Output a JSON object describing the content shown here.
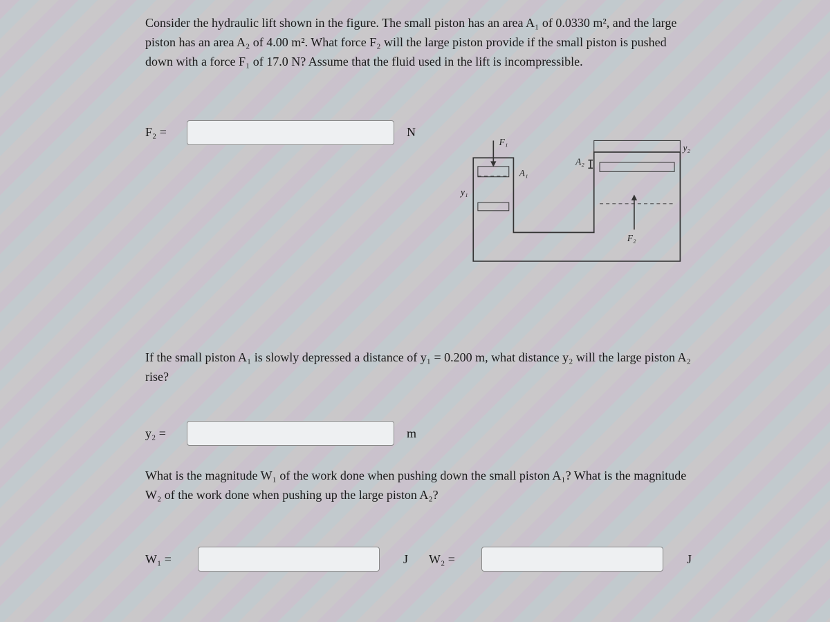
{
  "intro": "Consider the hydraulic lift shown in the figure. The small piston has an area A₁ of 0.0330 m², and the large piston has an area A₂ of 4.00 m². What force F₂ will the large piston provide if the small piston is pushed down with a force F₁ of 17.0 N? Assume that the fluid used in the lift is incompressible.",
  "q1": {
    "label": "F₂ =",
    "unit": "N",
    "value": ""
  },
  "q2_text": "If the small piston A₁ is slowly depressed a distance of y₁ = 0.200 m, what distance y₂ will the large piston A₂ rise?",
  "q2": {
    "label": "y₂ =",
    "unit": "m",
    "value": ""
  },
  "q3_text": "What is the magnitude W₁ of the work done when pushing down the small piston A₁? What is the magnitude W₂ of the work done when pushing up the large piston A₂?",
  "q3a": {
    "label": "W₁ =",
    "unit": "J",
    "value": ""
  },
  "q3b": {
    "label": "W₂ =",
    "unit": "J",
    "value": ""
  },
  "figure": {
    "F1": "F₁",
    "F2": "F₂",
    "A1": "A₁",
    "A2": "A₂",
    "y1": "y₁",
    "y2": "y₂"
  }
}
